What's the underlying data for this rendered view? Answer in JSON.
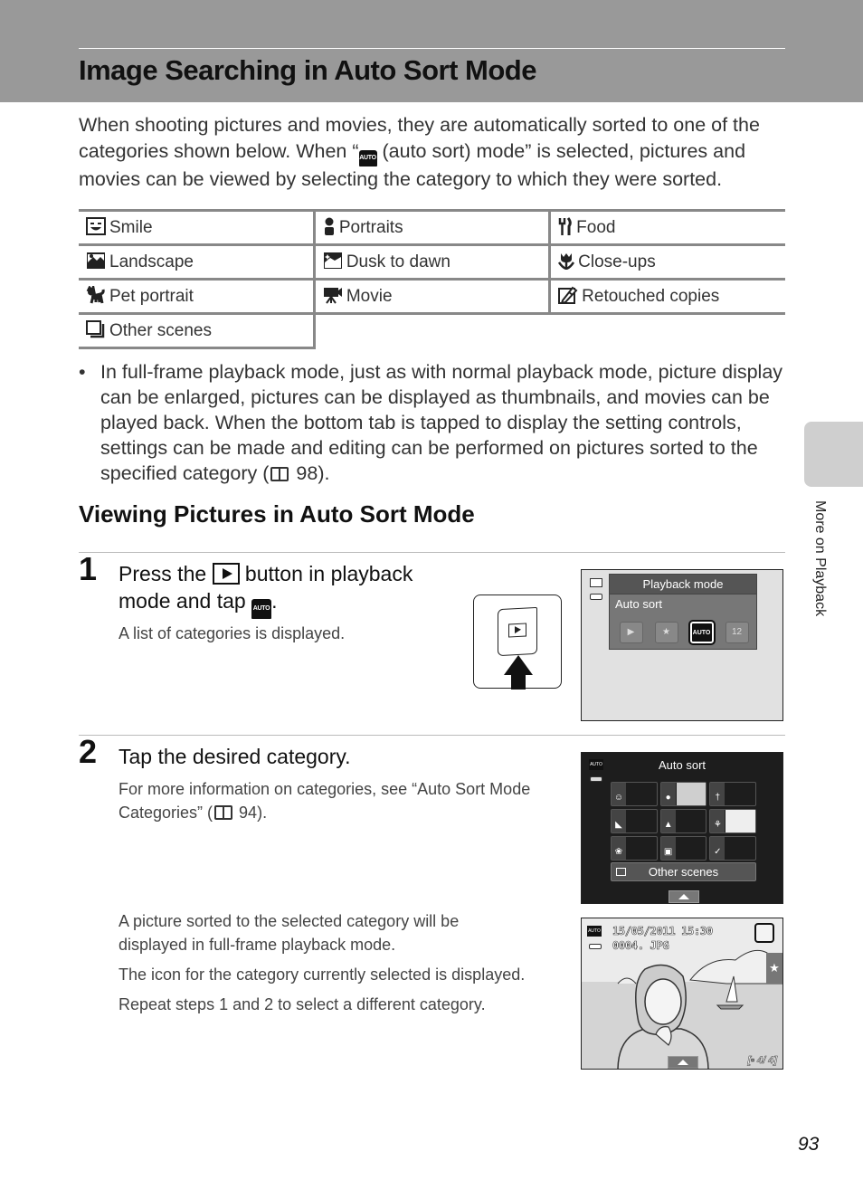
{
  "header": {
    "title": "Image Searching in Auto Sort Mode"
  },
  "intro": {
    "part1": "When shooting pictures and movies, they are automatically sorted to one of the categories shown below. When “",
    "auto_icon": "AUTO",
    "part2": " (auto sort) mode” is selected, pictures and movies can be viewed by selecting the category to which they were sorted."
  },
  "categories": [
    {
      "icon": "smile-icon",
      "label": "Smile"
    },
    {
      "icon": "portrait-icon",
      "label": "Portraits"
    },
    {
      "icon": "food-icon",
      "label": "Food"
    },
    {
      "icon": "landscape-icon",
      "label": "Landscape"
    },
    {
      "icon": "dusk-to-dawn-icon",
      "label": "Dusk to dawn"
    },
    {
      "icon": "close-up-icon",
      "label": "Close-ups"
    },
    {
      "icon": "pet-portrait-icon",
      "label": "Pet portrait"
    },
    {
      "icon": "movie-icon",
      "label": "Movie"
    },
    {
      "icon": "retouched-copies-icon",
      "label": "Retouched copies"
    },
    {
      "icon": "other-scenes-icon",
      "label": "Other scenes"
    }
  ],
  "bullet": {
    "text": "In full-frame playback mode, just as with normal playback mode, picture display can be enlarged, pictures can be displayed as thumbnails, and movies can be played back. When the bottom tab is tapped to display the setting controls, settings can be made and editing can be performed on pictures sorted to the specified category (",
    "ref": " 98)."
  },
  "section": {
    "title": "Viewing Pictures in Auto Sort Mode"
  },
  "steps": [
    {
      "number": "1",
      "title_part1": "Press the ",
      "title_part2": " button in playback mode and tap ",
      "title_part3": ".",
      "body": "A list of categories is displayed."
    },
    {
      "number": "2",
      "title": "Tap the desired category.",
      "body_part1": "For more information on categories, see “Auto Sort Mode Categories” (",
      "body_ref": " 94).",
      "notes": [
        "A picture sorted to the selected category will be displayed in full-frame playback mode.",
        "The icon for the category currently selected is displayed.",
        "Repeat steps 1 and 2 to select a different category."
      ]
    }
  ],
  "screen1": {
    "menu_title": "Playback mode",
    "selected_label": "Auto sort",
    "options": [
      "play-icon",
      "favorites-star-icon",
      "auto-sort-icon",
      "list-by-date-icon"
    ],
    "option_glyphs": [
      "▶",
      "★",
      "AUTO",
      "12"
    ]
  },
  "screen2": {
    "title": "Auto sort",
    "other_scenes_label": "Other scenes",
    "cell_glyphs": [
      "☺",
      "●",
      "†",
      "◣",
      "▲",
      "⚘",
      "❀",
      "▣",
      "✓"
    ]
  },
  "screen3": {
    "datetime": "15/05/2011  15:30",
    "filename": "0004. JPG",
    "counter": "[▫  4/    4]",
    "auto_icon": "AUTO",
    "star": "★"
  },
  "sidebar": {
    "chapter_label": "More on Playback"
  },
  "footer": {
    "page_number": "93"
  }
}
